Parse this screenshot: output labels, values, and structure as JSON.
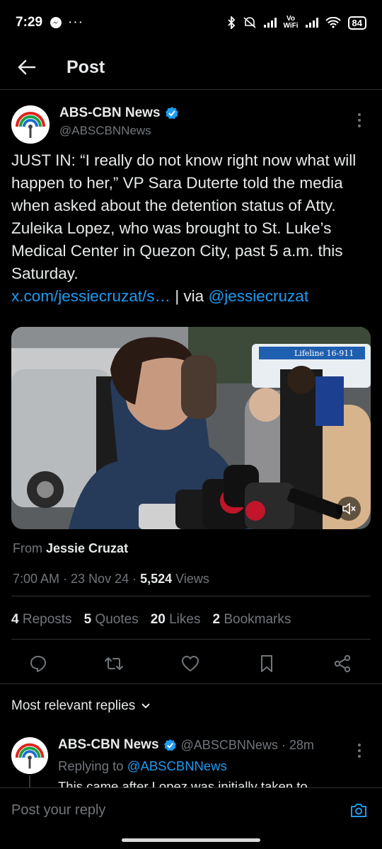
{
  "status_bar": {
    "time": "7:29",
    "left_icons": [
      "messenger-icon",
      "more-dots"
    ],
    "vowifi": "Vo\nWiFi",
    "battery": "84"
  },
  "header": {
    "title": "Post"
  },
  "post": {
    "author_name": "ABS-CBN News",
    "author_handle": "@ABSCBNNews",
    "text_main": "JUST IN: “I really do not know right now what will happen to her,” VP Sara Duterte told the media when asked about the detention status of Atty. Zuleika Lopez, who was brought to St. Luke’s Medical Center in Quezon City, past 5 a.m. this Saturday.",
    "text_link": "x.com/jessiecruzat/s…",
    "text_via": " | via ",
    "text_mention": "@jessiecruzat",
    "media_label": "Lifeline 16-911",
    "from_label": "From ",
    "from_name": "Jessie Cruzat",
    "time": "7:00 AM · 23 Nov 24 · ",
    "views_count": "5,524",
    "views_label": " Views",
    "stats": {
      "reposts_count": "4",
      "reposts_label": " Reposts",
      "quotes_count": "5",
      "quotes_label": " Quotes",
      "likes_count": "20",
      "likes_label": " Likes",
      "bookmarks_count": "2",
      "bookmarks_label": " Bookmarks"
    }
  },
  "replies": {
    "sort_label": "Most relevant replies",
    "first": {
      "name": "ABS-CBN News",
      "handle": "@ABSCBNNews · 28m",
      "replying_label": "Replying to ",
      "replying_handle": "@ABSCBNNews",
      "text": "This came after Lopez was initially taken to"
    }
  },
  "composer": {
    "placeholder": "Post your reply"
  },
  "colors": {
    "background": "#000000",
    "link": "#1d9bf0",
    "secondary_text": "#71767b",
    "primary_text": "#e7e9ea"
  }
}
